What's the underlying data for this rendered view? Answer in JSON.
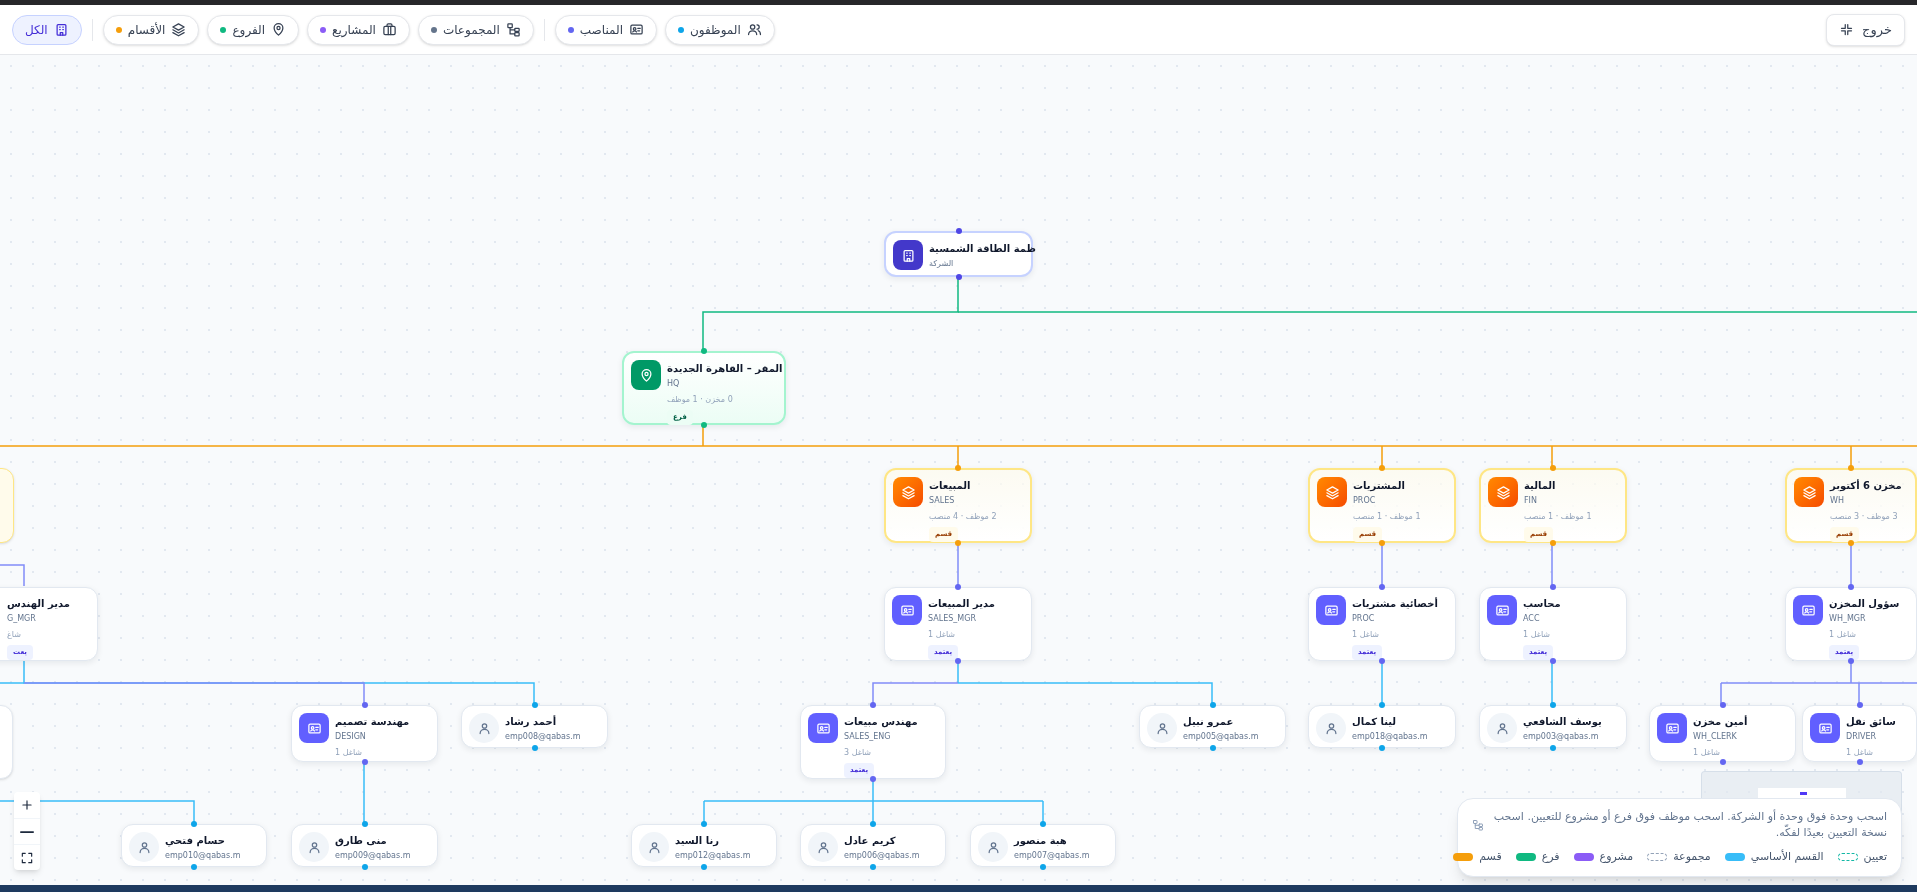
{
  "toolbar": {
    "exit_button": "خروج",
    "filters": [
      {
        "kind": "employees",
        "label": "الموظفون",
        "color": "#0ea5e9",
        "selected": false
      },
      {
        "kind": "positions",
        "label": "المناصب",
        "color": "#6366f1",
        "selected": false
      },
      {
        "kind": "groups",
        "label": "المجموعات",
        "color": "#64748b",
        "selected": false
      },
      {
        "kind": "projects",
        "label": "المشاريع",
        "color": "#8b5cf6",
        "selected": false
      },
      {
        "kind": "branches",
        "label": "الفروع",
        "color": "#10b981",
        "selected": false
      },
      {
        "kind": "departments",
        "label": "الأقسام",
        "color": "#f59e0b",
        "selected": false
      },
      {
        "kind": "all",
        "label": "الكل",
        "selected": true
      }
    ]
  },
  "nodes": [
    {
      "kind": "company",
      "title": "ظمة الطاقة الشمسية",
      "code": "الشركة"
    },
    {
      "kind": "branch",
      "title": "المقر – القاهرة الجديدة",
      "code": "HQ",
      "stats": "0 مخزن · 1 موظف",
      "badge": "فرع"
    },
    {
      "kind": "department",
      "title": "مخزن 6 أكتوبر",
      "code": "WH",
      "stats": "3 موظف · 3 منصب",
      "badge": "قسم"
    },
    {
      "kind": "department",
      "title": "المالية",
      "code": "FIN",
      "stats": "1 موظف · 1 منصب",
      "badge": "قسم"
    },
    {
      "kind": "department",
      "title": "المشتريات",
      "code": "PROC",
      "stats": "1 موظف · 1 منصب",
      "badge": "قسم"
    },
    {
      "kind": "department",
      "title": "المبيعات",
      "code": "SALES",
      "stats": "2 موظف · 4 منصب",
      "badge": "قسم"
    },
    {
      "kind": "position",
      "title": "سؤول المخزن",
      "code": "WH_MGR",
      "stats": "شاغل 1",
      "badge": "يعتمد"
    },
    {
      "kind": "position",
      "title": "محاسب",
      "code": "ACC",
      "stats": "شاغل 1",
      "badge": "يعتمد"
    },
    {
      "kind": "position",
      "title": "أخصائية مشتريات",
      "code": "PROC",
      "stats": "شاغل 1",
      "badge": "يعتمد"
    },
    {
      "kind": "position",
      "title": "مدير المبيعات",
      "code": "SALES_MGR",
      "stats": "شاغل 1",
      "badge": "يعتمد"
    },
    {
      "kind": "position",
      "title": "مدير الهندس",
      "code": "G_MGR",
      "stats": "شاغ",
      "badge": "يعت"
    },
    {
      "kind": "position",
      "title": "سائق نقل",
      "code": "DRIVER",
      "stats": "شاغل 1"
    },
    {
      "kind": "position",
      "title": "أمين مخزن",
      "code": "WH_CLERK",
      "stats": "شاغل 1"
    },
    {
      "kind": "employee",
      "title": "يوسف الشافعي",
      "code": "emp003@qabas.m"
    },
    {
      "kind": "employee",
      "title": "لينا كمال",
      "code": "emp018@qabas.m"
    },
    {
      "kind": "employee",
      "title": "عمرو نبيل",
      "code": "emp005@qabas.m"
    },
    {
      "kind": "position",
      "title": "مهندس مبيعات",
      "code": "SALES_ENG",
      "stats": "شاغل 3",
      "badge": "يعتمد"
    },
    {
      "kind": "employee",
      "title": "أحمد رشاد",
      "code": "emp008@qabas.m"
    },
    {
      "kind": "position",
      "title": "مهندسة تصميم",
      "code": "DESIGN",
      "stats": "شاغل 1"
    },
    {
      "kind": "employee",
      "title": "هبة منصور",
      "code": "emp007@qabas.m"
    },
    {
      "kind": "employee",
      "title": "كريم عادل",
      "code": "emp006@qabas.m"
    },
    {
      "kind": "employee",
      "title": "رنا السيد",
      "code": "emp012@qabas.m"
    },
    {
      "kind": "employee",
      "title": "منى طارق",
      "code": "emp009@qabas.m"
    },
    {
      "kind": "employee",
      "title": "حسام فتحي",
      "code": "emp010@qabas.m"
    }
  ],
  "legend": {
    "hint": "اسحب وحدة فوق وحدة أو الشركة. اسحب موظف فوق فرع أو مشروع للتعيين. اسحب نسخة التعيين بعيدًا لفكّه.",
    "items": [
      {
        "kind": "dashed",
        "label": "تعيين",
        "color": "#14b8a6"
      },
      {
        "kind": "solid",
        "label": "القسم الأساسي",
        "color": "#38bdf8"
      },
      {
        "kind": "dashed",
        "label": "مجموعة",
        "color": "#94a3b8"
      },
      {
        "kind": "solid",
        "label": "مشروع",
        "color": "#8b5cf6"
      },
      {
        "kind": "solid",
        "label": "فرع",
        "color": "#10b981"
      },
      {
        "kind": "solid",
        "label": "قسم",
        "color": "#f59e0b"
      }
    ]
  }
}
